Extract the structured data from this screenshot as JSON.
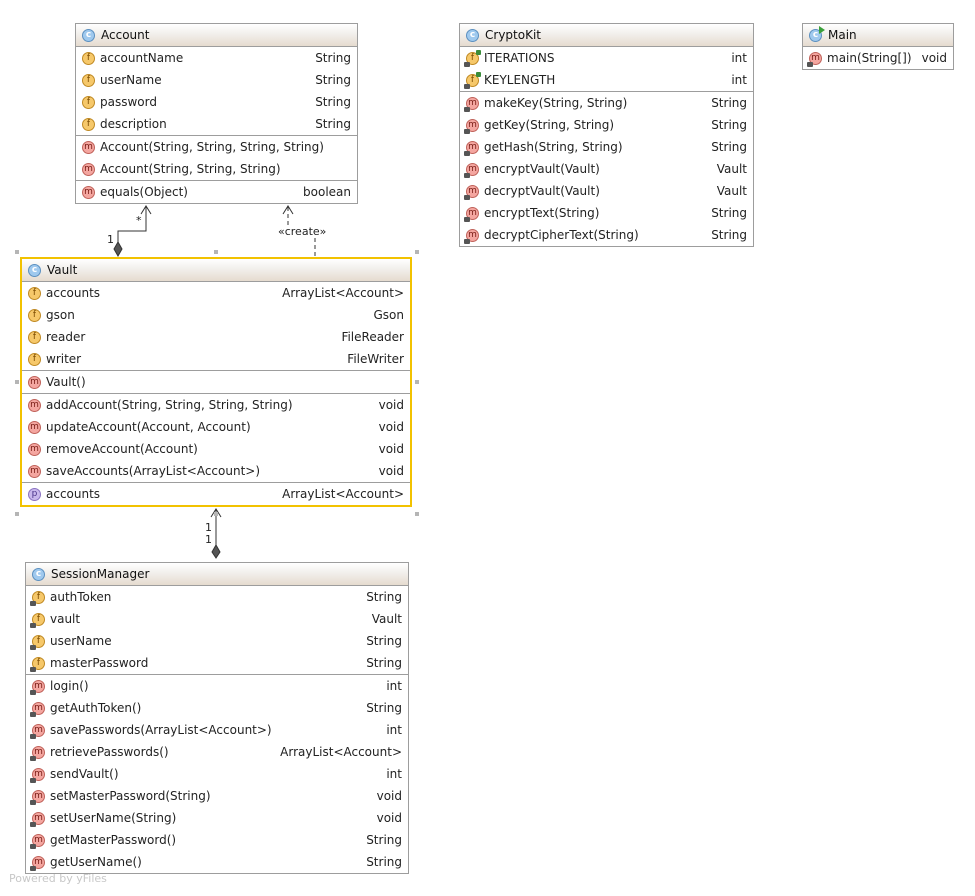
{
  "classes": {
    "account": {
      "name": "Account",
      "fields": [
        {
          "name": "accountName",
          "type": "String"
        },
        {
          "name": "userName",
          "type": "String"
        },
        {
          "name": "password",
          "type": "String"
        },
        {
          "name": "description",
          "type": "String"
        }
      ],
      "constructors": [
        {
          "name": "Account(String, String, String, String)",
          "type": ""
        },
        {
          "name": "Account(String, String, String)",
          "type": ""
        }
      ],
      "methods": [
        {
          "name": "equals(Object)",
          "type": "boolean"
        }
      ]
    },
    "cryptokit": {
      "name": "CryptoKit",
      "fields": [
        {
          "name": "ITERATIONS",
          "type": "int"
        },
        {
          "name": "KEYLENGTH",
          "type": "int"
        }
      ],
      "methods": [
        {
          "name": "makeKey(String, String)",
          "type": "String"
        },
        {
          "name": "getKey(String, String)",
          "type": "String"
        },
        {
          "name": "getHash(String, String)",
          "type": "String"
        },
        {
          "name": "encryptVault(Vault)",
          "type": "Vault"
        },
        {
          "name": "decryptVault(Vault)",
          "type": "Vault"
        },
        {
          "name": "encryptText(String)",
          "type": "String"
        },
        {
          "name": "decryptCipherText(String)",
          "type": "String"
        }
      ]
    },
    "main": {
      "name": "Main",
      "methods": [
        {
          "name": "main(String[])",
          "type": "void"
        }
      ]
    },
    "vault": {
      "name": "Vault",
      "fields": [
        {
          "name": "accounts",
          "type": "ArrayList<Account>"
        },
        {
          "name": "gson",
          "type": "Gson"
        },
        {
          "name": "reader",
          "type": "FileReader"
        },
        {
          "name": "writer",
          "type": "FileWriter"
        }
      ],
      "constructors": [
        {
          "name": "Vault()",
          "type": ""
        }
      ],
      "methods": [
        {
          "name": "addAccount(String, String, String, String)",
          "type": "void"
        },
        {
          "name": "updateAccount(Account, Account)",
          "type": "void"
        },
        {
          "name": "removeAccount(Account)",
          "type": "void"
        },
        {
          "name": "saveAccounts(ArrayList<Account>)",
          "type": "void"
        }
      ],
      "properties": [
        {
          "name": "accounts",
          "type": "ArrayList<Account>"
        }
      ]
    },
    "sessionmanager": {
      "name": "SessionManager",
      "fields": [
        {
          "name": "authToken",
          "type": "String"
        },
        {
          "name": "vault",
          "type": "Vault"
        },
        {
          "name": "userName",
          "type": "String"
        },
        {
          "name": "masterPassword",
          "type": "String"
        }
      ],
      "methods": [
        {
          "name": "login()",
          "type": "int"
        },
        {
          "name": "getAuthToken()",
          "type": "String"
        },
        {
          "name": "savePasswords(ArrayList<Account>)",
          "type": "int"
        },
        {
          "name": "retrievePasswords()",
          "type": "ArrayList<Account>"
        },
        {
          "name": "sendVault()",
          "type": "int"
        },
        {
          "name": "setMasterPassword(String)",
          "type": "void"
        },
        {
          "name": "setUserName(String)",
          "type": "void"
        },
        {
          "name": "getMasterPassword()",
          "type": "String"
        },
        {
          "name": "getUserName()",
          "type": "String"
        }
      ]
    }
  },
  "edges": {
    "vault_account": {
      "source_mult": "1",
      "target_mult": "*"
    },
    "vault_account_create": {
      "label": "«create»"
    },
    "session_vault": {
      "mult_top": "1",
      "mult_bottom": "1"
    }
  },
  "icon_letters": {
    "class": "c",
    "field": "f",
    "method": "m",
    "property": "p"
  },
  "footer": {
    "powered": "Powered by yFiles"
  },
  "colors": {
    "selection": "#f2c200",
    "border": "#9d9d9d",
    "header_gradient_end": "#e6dbcf"
  }
}
